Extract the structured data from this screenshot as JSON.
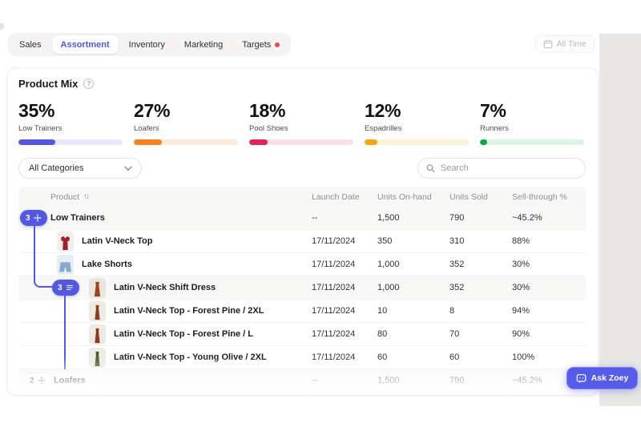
{
  "nav": {
    "tabs": [
      {
        "label": "Sales",
        "active": false
      },
      {
        "label": "Assortment",
        "active": true
      },
      {
        "label": "Inventory",
        "active": false
      },
      {
        "label": "Marketing",
        "active": false
      },
      {
        "label": "Targets",
        "active": false,
        "alert_dot": true
      }
    ],
    "date_filter_label": "All Time"
  },
  "product_mix": {
    "title": "Product Mix",
    "help_icon": "?",
    "stats": [
      {
        "percent": "35%",
        "label": "Low Trainers",
        "bar_width": "35%",
        "color": "#5458e0",
        "track": "#e7e8fb"
      },
      {
        "percent": "27%",
        "label": "Loafers",
        "bar_width": "27%",
        "color": "#f6831f",
        "track": "#fcecdb"
      },
      {
        "percent": "18%",
        "label": "Pool Shoes",
        "bar_width": "18%",
        "color": "#e02454",
        "track": "#fae0e8"
      },
      {
        "percent": "12%",
        "label": "Espadrilles",
        "bar_width": "12%",
        "color": "#f0a714",
        "track": "#fbf2d7"
      },
      {
        "percent": "7%",
        "label": "Runners",
        "bar_width": "7%",
        "color": "#17a34a",
        "track": "#def2e6"
      }
    ]
  },
  "filters": {
    "category_value": "All Categories",
    "search_placeholder": "Search"
  },
  "table": {
    "sort_icon": "↑↓",
    "columns": [
      "Product",
      "Launch Date",
      "Units On-hand",
      "Units Sold",
      "Sell-through %"
    ],
    "rows": [
      {
        "badge": "3",
        "name": "Low Trainers",
        "launch_date": "--",
        "units_on_hand": "1,500",
        "units_sold": "790",
        "sell_through": "~45.2%",
        "thumb": ""
      },
      {
        "name": "Latin V-Neck Top",
        "launch_date": "17/11/2024",
        "units_on_hand": "350",
        "units_sold": "310",
        "sell_through": "88%",
        "thumb": "red-top"
      },
      {
        "name": "Lake Shorts",
        "launch_date": "17/11/2024",
        "units_on_hand": "1,000",
        "units_sold": "352",
        "sell_through": "30%",
        "thumb": "denim-shorts"
      },
      {
        "badge": "3",
        "name": "Latin V-Neck Shift Dress",
        "launch_date": "17/11/2024",
        "units_on_hand": "1,000",
        "units_sold": "352",
        "sell_through": "30%",
        "thumb": "rust-dress"
      },
      {
        "name": "Latin V-Neck Top - Forest Pine / 2XL",
        "launch_date": "17/11/2024",
        "units_on_hand": "10",
        "units_sold": "8",
        "sell_through": "94%",
        "thumb": "brown-dress"
      },
      {
        "name": "Latin V-Neck Top - Forest Pine / L",
        "launch_date": "17/11/2024",
        "units_on_hand": "80",
        "units_sold": "70",
        "sell_through": "90%",
        "thumb": "brown-dress"
      },
      {
        "name": "Latin V-Neck Top - Young Olive / 2XL",
        "launch_date": "17/11/2024",
        "units_on_hand": "60",
        "units_sold": "60",
        "sell_through": "100%",
        "thumb": "olive-dress"
      },
      {
        "badge": "2",
        "name": "Loafers",
        "launch_date": "--",
        "units_on_hand": "1,500",
        "units_sold": "790",
        "sell_through": "~45.2%",
        "thumb": ""
      }
    ]
  },
  "ask_zoey": {
    "label": "Ask Zoey"
  },
  "colors": {
    "accent": "#5458e0",
    "side_panel": "#e8e7e4",
    "targets_dot": "#e8475f"
  }
}
